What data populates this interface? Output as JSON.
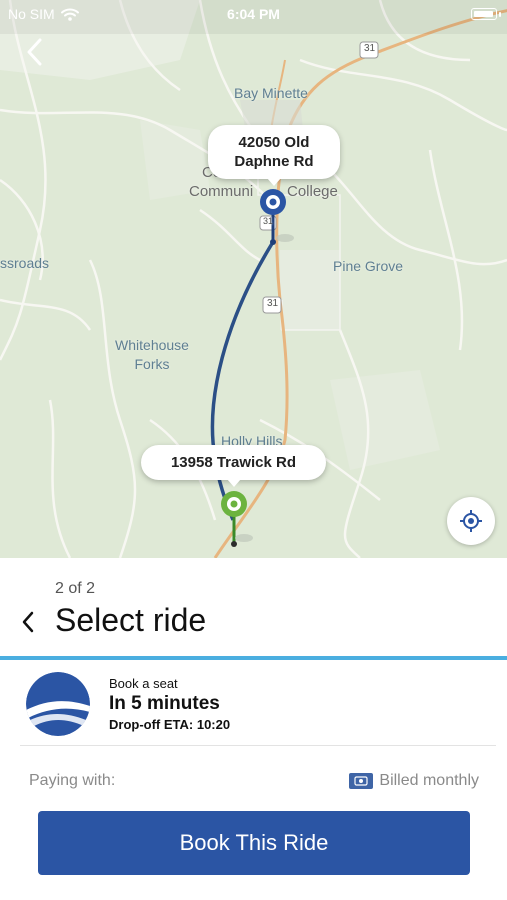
{
  "status_bar": {
    "carrier": "No SIM",
    "time": "6:04 PM"
  },
  "map": {
    "labels": {
      "bay_minette": "Bay Minette",
      "college_line1": "Co",
      "college_line2": "Communi",
      "college_line3": "College",
      "pine_grove": "Pine Grove",
      "crossroads": "ssroads",
      "whitehouse_forks": "Whitehouse Forks",
      "holly_hills": "Holly Hills",
      "highway_31": "31"
    },
    "pickup_label_line1": "42050 Old",
    "pickup_label_line2": "Daphne Rd",
    "dropoff_label": "13958 Trawick Rd",
    "route_color": "#2b4f86",
    "pickup_color": "#2b55a4",
    "dropoff_color": "#6cb33f"
  },
  "sheet": {
    "step": "2 of 2",
    "title": "Select ride",
    "ride": {
      "type": "Book a seat",
      "eta": "In 5 minutes",
      "dropoff": "Drop-off ETA: 10:20"
    },
    "paying_label": "Paying with:",
    "payment_method": "Billed monthly",
    "book_button": "Book This Ride"
  },
  "colors": {
    "accent": "#2b55a4",
    "progress": "#4aaee0"
  }
}
